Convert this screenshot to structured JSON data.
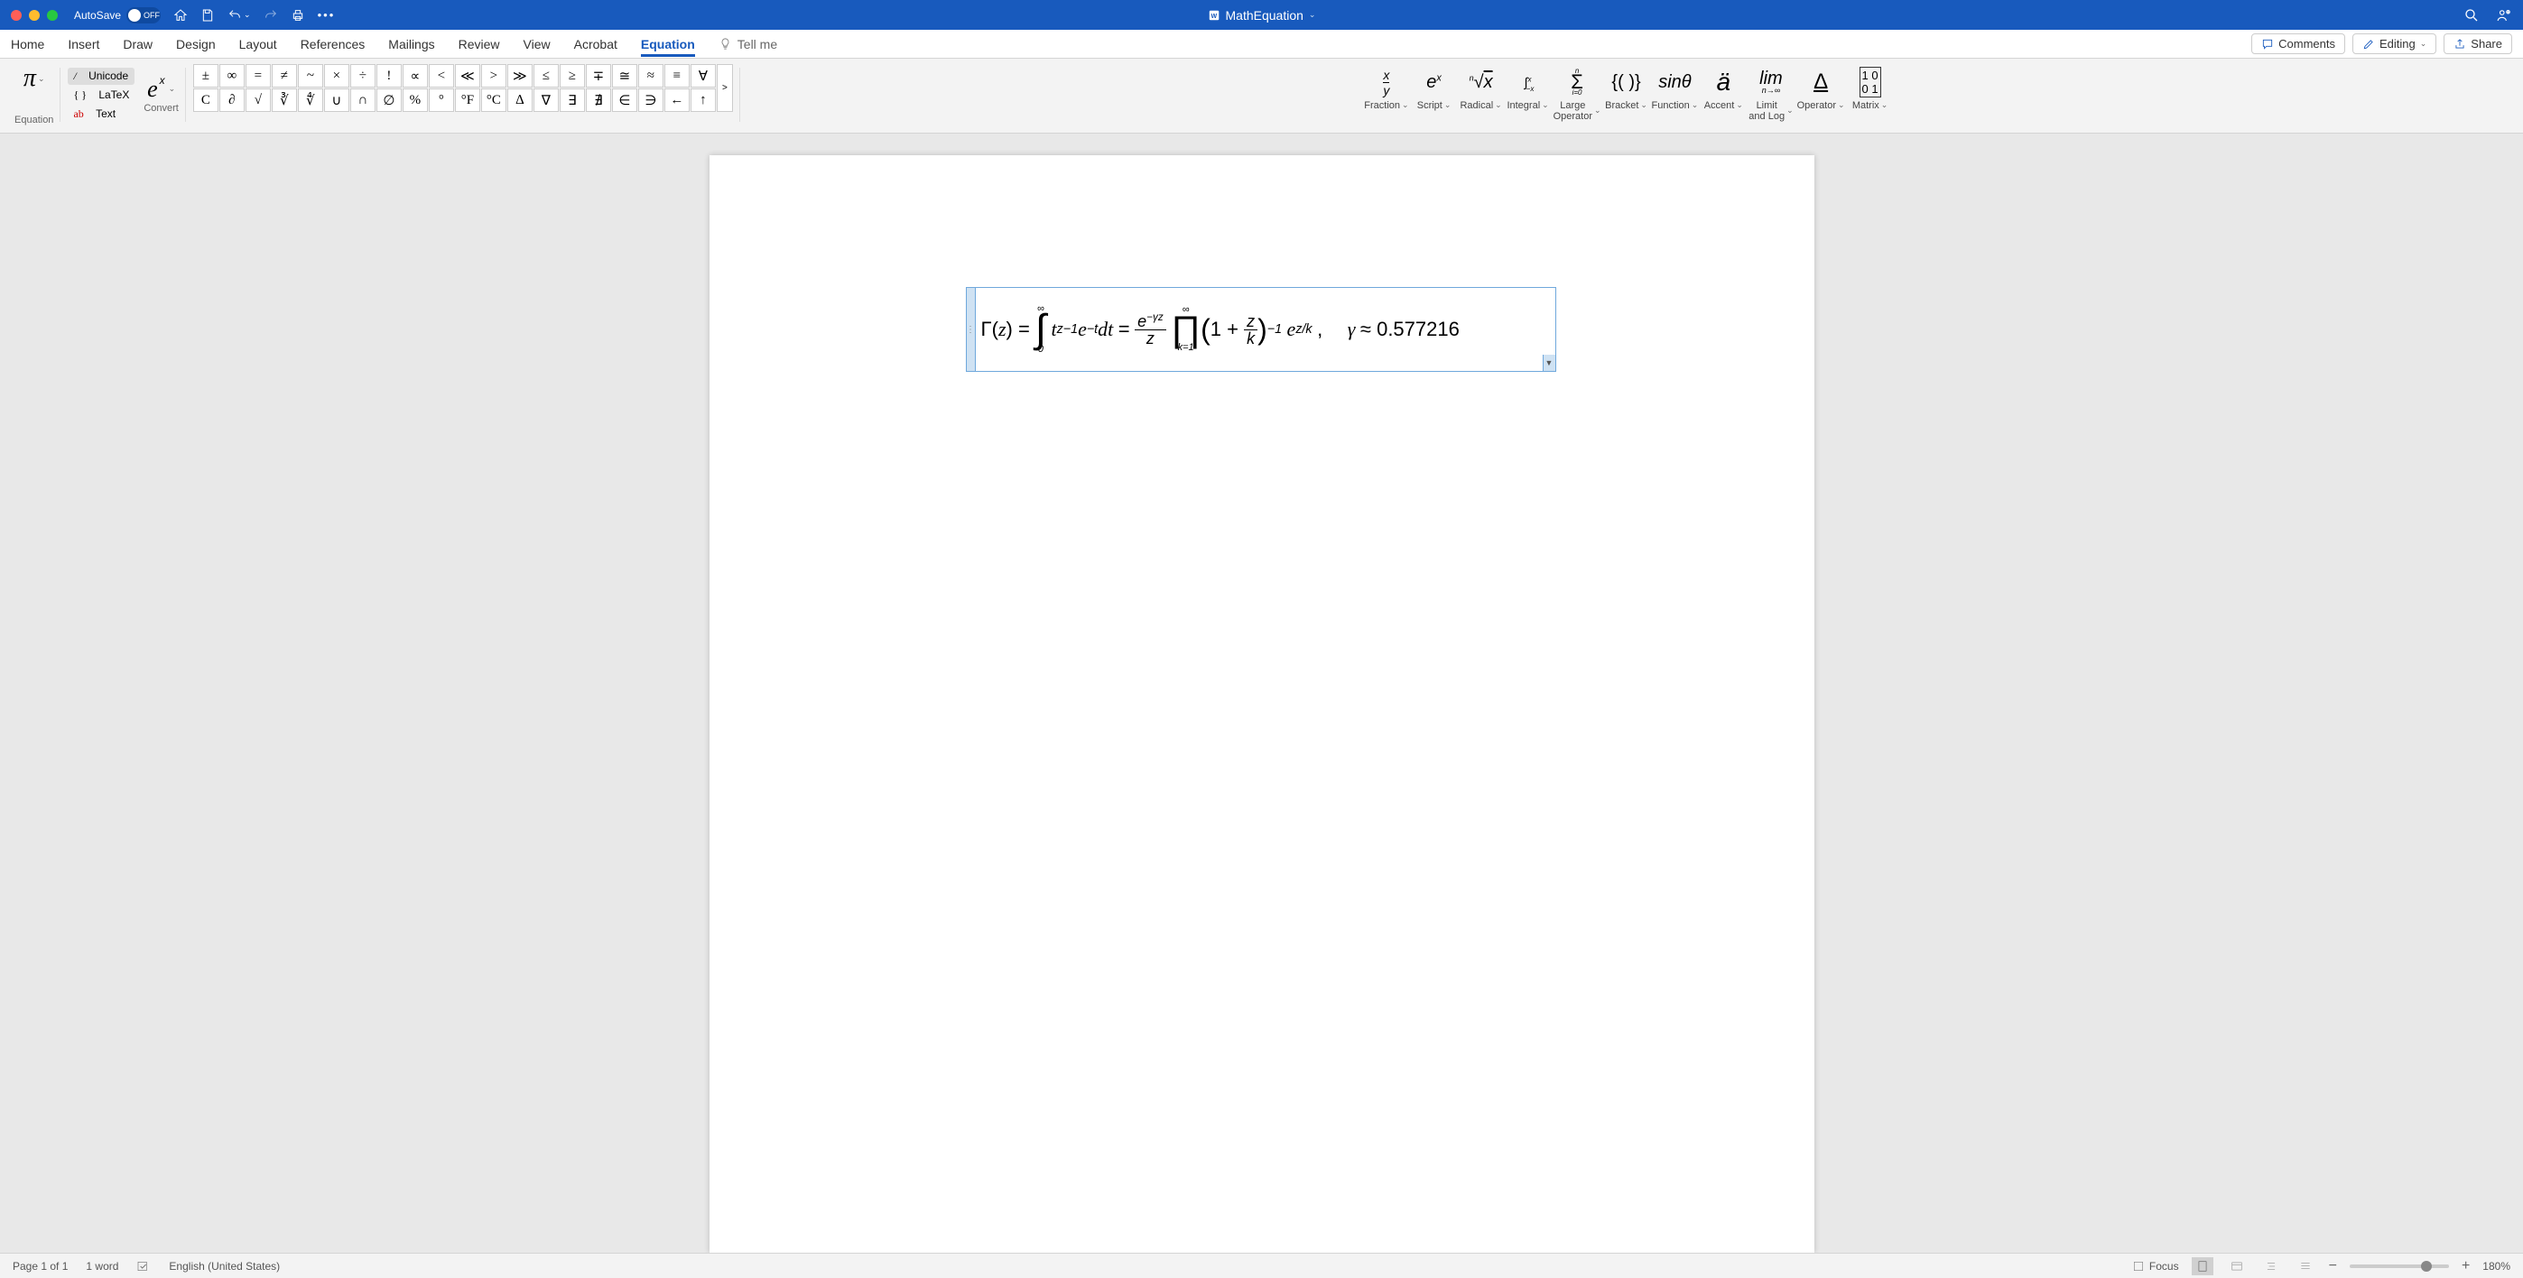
{
  "titlebar": {
    "autosave_label": "AutoSave",
    "autosave_state": "OFF",
    "doc_name": "MathEquation"
  },
  "tabs": {
    "items": [
      "Home",
      "Insert",
      "Draw",
      "Design",
      "Layout",
      "References",
      "Mailings",
      "Review",
      "View",
      "Acrobat",
      "Equation"
    ],
    "active": "Equation",
    "tellme": "Tell me",
    "comments": "Comments",
    "editing": "Editing",
    "share": "Share"
  },
  "ribbon": {
    "equation_label": "Equation",
    "tools": {
      "unicode": "Unicode",
      "latex": "LaTeX",
      "text": "Text"
    },
    "convert_label": "Convert",
    "symbols_row1": [
      "±",
      "∞",
      "=",
      "≠",
      "~",
      "×",
      "÷",
      "!",
      "∝",
      "<",
      "≪",
      ">",
      "≫",
      "≤",
      "≥",
      "∓",
      "≅",
      "≈",
      "≡",
      "∀"
    ],
    "symbols_row2": [
      "C",
      "∂",
      "√",
      "∛",
      "∜",
      "∪",
      "∩",
      "∅",
      "%",
      "°",
      "°F",
      "°C",
      "∆",
      "∇",
      "∃",
      "∄",
      "∈",
      "∋",
      "←",
      "↑"
    ],
    "structures": [
      {
        "label": "Fraction"
      },
      {
        "label": "Script"
      },
      {
        "label": "Radical"
      },
      {
        "label": "Integral"
      },
      {
        "label": "Large Operator"
      },
      {
        "label": "Bracket"
      },
      {
        "label": "Function"
      },
      {
        "label": "Accent"
      },
      {
        "label": "Limit and Log"
      },
      {
        "label": "Operator"
      },
      {
        "label": "Matrix"
      }
    ]
  },
  "equation": {
    "lhs": "Γ(z) =",
    "int_upper": "∞",
    "int_lower": "0",
    "integrand": "t^{z-1} e^{-t} dt",
    "eq2": "=",
    "frac_num": "e^{-γz}",
    "frac_den": "z",
    "prod_upper": "∞",
    "prod_lower": "k=1",
    "prod_body": "(1 + z/k)^{-1} e^{z/k}",
    "tail": ",    γ ≈ 0.577216"
  },
  "status": {
    "page": "Page 1 of 1",
    "words": "1 word",
    "lang": "English (United States)",
    "focus": "Focus",
    "zoom": "180%"
  }
}
